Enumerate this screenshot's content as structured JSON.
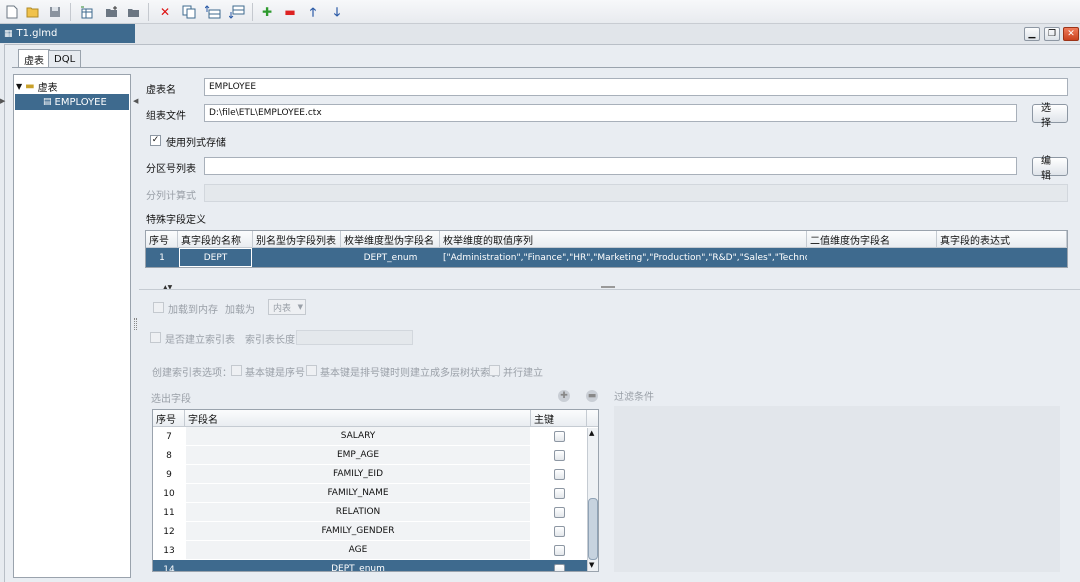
{
  "window": {
    "doc_tab": "T1.glmd"
  },
  "toolbar": {
    "icons": [
      "new-file-icon",
      "open-folder-icon",
      "save-icon",
      "new-table-icon",
      "folder-add-icon",
      "folder-icon",
      "delete-icon",
      "copy-icon",
      "insert-row-above-icon",
      "insert-row-below-icon",
      "add-icon",
      "remove-icon",
      "move-up-icon",
      "move-down-icon"
    ]
  },
  "tabs": [
    "虚表",
    "DQL"
  ],
  "tree": {
    "root": "虚表",
    "child": "EMPLOYEE"
  },
  "form": {
    "name_label": "虚表名",
    "name_value": "EMPLOYEE",
    "file_label": "组表文件",
    "file_value": "D:\\file\\ETL\\EMPLOYEE.ctx",
    "choose_button": "选择",
    "columnar_label": "使用列式存储",
    "columnar_checked": true,
    "partition_label": "分区号列表",
    "edit_button": "编辑",
    "partition_expr_label": "分列计算式",
    "special_fields_label": "特殊字段定义"
  },
  "special_table": {
    "columns": [
      "序号",
      "真字段的名称",
      "别名型伪字段列表",
      "枚举维度型伪字段名",
      "枚举维度的取值序列",
      "二值维度伪字段名",
      "真字段的表达式"
    ],
    "rows": [
      [
        "1",
        "DEPT",
        "",
        "DEPT_enum",
        "[\"Administration\",\"Finance\",\"HR\",\"Marketing\",\"Production\",\"R&D\",\"Sales\",\"Technology\"]",
        "",
        ""
      ]
    ]
  },
  "lower": {
    "load_memory_label": "加载到内存",
    "load_as_label": "加载为",
    "load_as_value": "内表",
    "create_index_label": "是否建立索引表",
    "index_length_label": "索引表长度",
    "index_options_label": "创建索引表选项：",
    "opt_basic_seq": "基本键是序号",
    "opt_basic_sorted": "基本键是排号键时则建立成多层树状索引",
    "opt_parallel": "并行建立",
    "selected_fields_label": "选出字段",
    "filter_label": "过滤条件"
  },
  "fields_table": {
    "columns": [
      "序号",
      "字段名",
      "主键"
    ],
    "rows": [
      {
        "num": "7",
        "name": "SALARY",
        "selected": false
      },
      {
        "num": "8",
        "name": "EMP_AGE",
        "selected": false
      },
      {
        "num": "9",
        "name": "FAMILY_EID",
        "selected": false
      },
      {
        "num": "10",
        "name": "FAMILY_NAME",
        "selected": false
      },
      {
        "num": "11",
        "name": "RELATION",
        "selected": false
      },
      {
        "num": "12",
        "name": "FAMILY_GENDER",
        "selected": false
      },
      {
        "num": "13",
        "name": "AGE",
        "selected": false
      },
      {
        "num": "14",
        "name": "DEPT_enum",
        "selected": true
      }
    ]
  }
}
